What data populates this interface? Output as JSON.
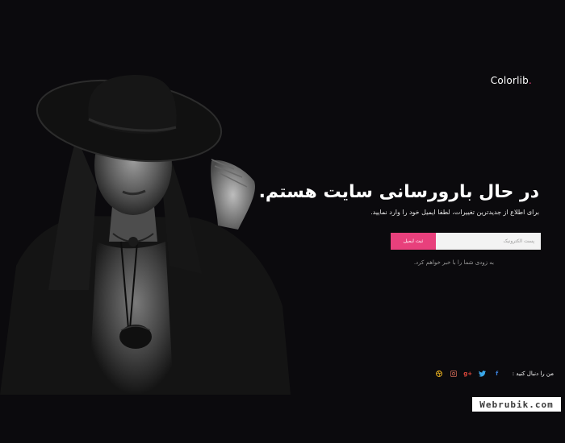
{
  "brand": {
    "logo_text": "Colorlib",
    "logo_dot": ".",
    "accent": "#e8407c"
  },
  "hero": {
    "title": "در حال بارورسانی سایت هستم.",
    "subtitle": "برای اطلاع از جدیدترین تغییرات، لطفا ایمیل خود را وارد نمایید."
  },
  "form": {
    "email_placeholder": "پست الکترونیک",
    "submit_label": "ثبت ایمیل"
  },
  "note": "به زودی شما را با خبر خواهم کرد.",
  "social": {
    "follow_label": "من را دنبال کنید :",
    "icons": [
      {
        "name": "facebook-icon",
        "glyph": "f",
        "color": "#3b7fd9"
      },
      {
        "name": "twitter-icon",
        "glyph": "✦",
        "color": "#3aa7e8"
      },
      {
        "name": "google-plus-icon",
        "glyph": "g+",
        "color": "#e0483b"
      },
      {
        "name": "instagram-icon",
        "glyph": "◙",
        "color": "#b05a4a"
      },
      {
        "name": "dribbble-icon",
        "glyph": "◎",
        "color": "#e8b020"
      }
    ]
  },
  "watermark": "Webrubik.com"
}
